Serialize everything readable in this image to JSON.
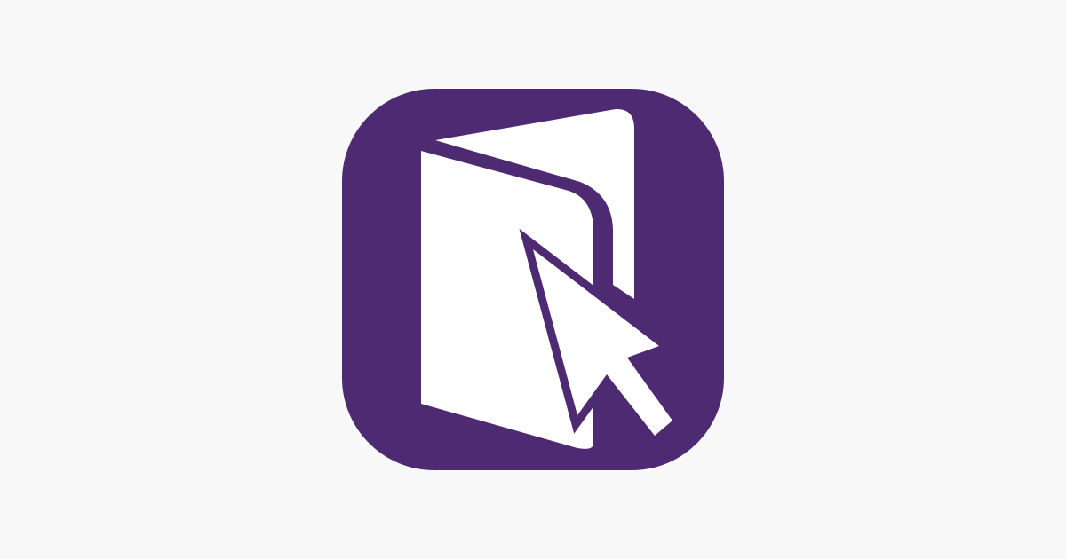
{
  "page": {
    "background_color": "#f8f8f8"
  },
  "app_icon": {
    "background_color": "#4e2a72",
    "glyph_color": "#ffffff",
    "glyph": "book-cursor-icon"
  }
}
